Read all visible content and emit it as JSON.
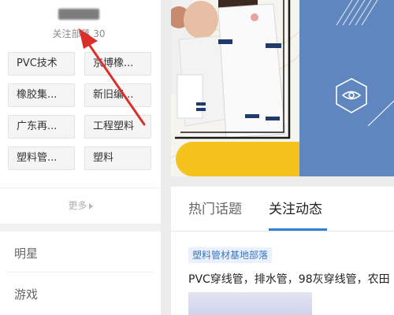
{
  "tribes": {
    "follow_count_label": "关注部落 30",
    "tags": [
      "PVC技术",
      "京博橡...",
      "橡胶集...",
      "新旧编...",
      "广东再...",
      "工程塑料",
      "塑料管...",
      "塑料"
    ]
  },
  "more_label": "更多",
  "categories": [
    "明星",
    "游戏"
  ],
  "tabs": {
    "hot": "热门话题",
    "follow": "关注动态"
  },
  "post": {
    "tribe_tag": "塑料管材基地部落",
    "text": "PVC穿线管，排水管，98灰穿线管，农田"
  },
  "colors": {
    "accent": "#2f83d7",
    "annotation_arrow": "#d9302b"
  },
  "icons": {
    "more": "caret-right-icon",
    "banner": "eye-icon"
  }
}
